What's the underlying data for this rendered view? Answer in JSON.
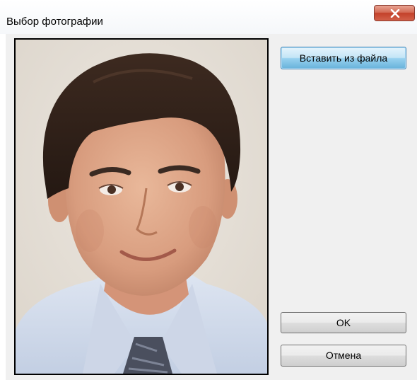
{
  "window": {
    "title": "Выбор фотографии"
  },
  "photo": {
    "description_icon": "person-photo"
  },
  "buttons": {
    "insert_from_file": "Вставить из файла",
    "ok": "OK",
    "cancel": "Отмена"
  },
  "colors": {
    "close_button": "#c3412a",
    "focused_button": "#98d1ef",
    "dialog_background": "#f0f0f0"
  }
}
